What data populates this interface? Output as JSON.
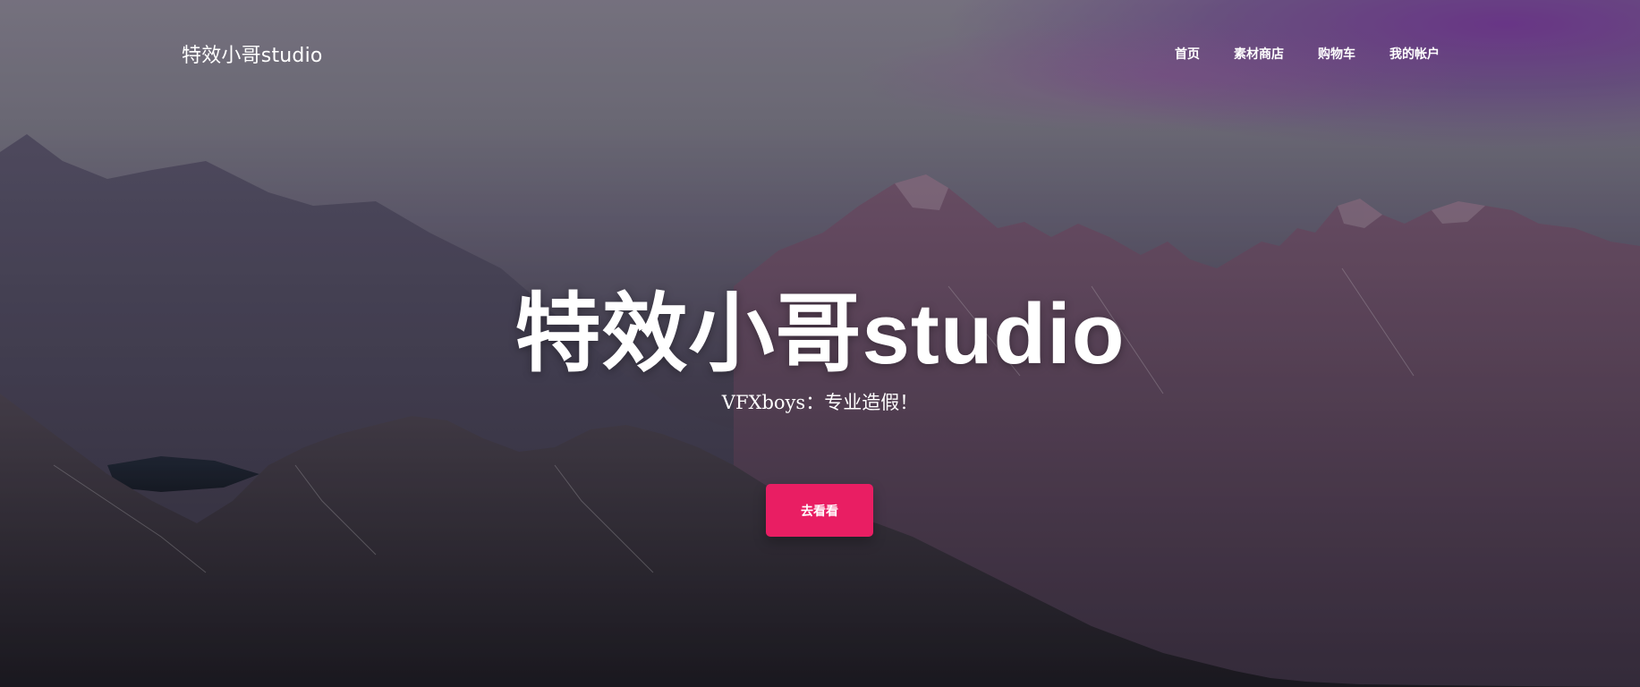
{
  "brand": "特效小哥studio",
  "nav": [
    {
      "label": "首页"
    },
    {
      "label": "素材商店"
    },
    {
      "label": "购物车"
    },
    {
      "label": "我的帐户"
    }
  ],
  "hero": {
    "title": "特效小哥studio",
    "subtitle": "VFXboys：专业造假！",
    "cta_label": "去看看"
  },
  "colors": {
    "accent": "#e91e63",
    "text": "#ffffff"
  }
}
